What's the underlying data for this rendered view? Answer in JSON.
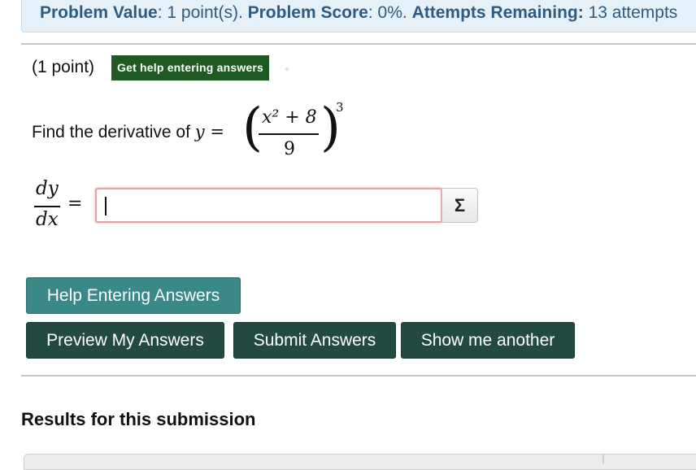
{
  "status": {
    "value_label": "Problem Value",
    "value_text": ": 1 point(s).",
    "score_label": "Problem Score",
    "score_text": ": 0%.",
    "attempts_label": "Attempts Remaining:",
    "attempts_text": " 13 attempts"
  },
  "problem": {
    "points": "(1 point)",
    "help_link": "Get help entering answers",
    "prompt": "Find the derivative of ",
    "y_var": "y",
    "equals": " = ",
    "numerator": "x² + 8",
    "denominator": "9",
    "exponent": "3"
  },
  "answer": {
    "lhs_num": "dy",
    "lhs_den": "dx",
    "eq_sign": "=",
    "value": "",
    "equation_editor_symbol": "Σ"
  },
  "buttons": {
    "help": "Help Entering Answers",
    "preview": "Preview My Answers",
    "submit": "Submit Answers",
    "another": "Show me another"
  },
  "results": {
    "heading": "Results for this submission"
  },
  "colors": {
    "status_text": "#2f5b82",
    "status_bg": "#e6f0f8",
    "help_badge_bg": "#1f5a24",
    "help_button_bg": "#3a8887",
    "action_button_bg": "#234a40",
    "input_border_error": "#d9a7a7"
  },
  "icons": {
    "equation_editor": "sigma-icon"
  }
}
